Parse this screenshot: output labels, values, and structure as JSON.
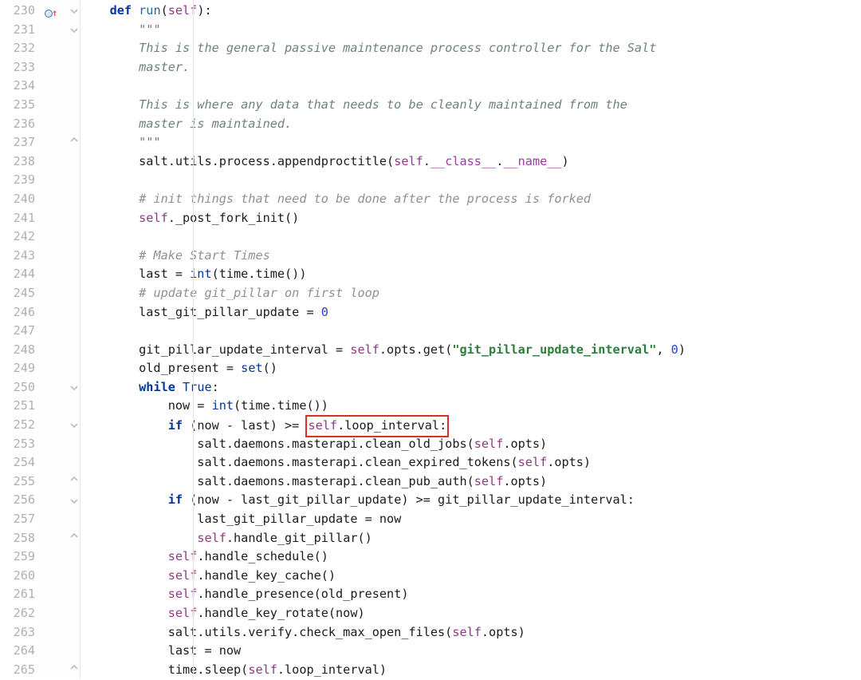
{
  "editor": {
    "first_line": 230,
    "last_line": 265,
    "highlight_text": "self.loop_interval:",
    "override_marker_line": 230
  },
  "fold_markers": [
    {
      "line": 230,
      "type": "open"
    },
    {
      "line": 231,
      "type": "open"
    },
    {
      "line": 237,
      "type": "close"
    },
    {
      "line": 250,
      "type": "open"
    },
    {
      "line": 252,
      "type": "open"
    },
    {
      "line": 255,
      "type": "close"
    },
    {
      "line": 256,
      "type": "open"
    },
    {
      "line": 258,
      "type": "close"
    },
    {
      "line": 265,
      "type": "close"
    }
  ],
  "code": [
    [
      [
        "pln",
        "    "
      ],
      [
        "kw",
        "def "
      ],
      [
        "fn",
        "run"
      ],
      [
        "pln",
        "("
      ],
      [
        "slf",
        "self"
      ],
      [
        "pln",
        "):"
      ]
    ],
    [
      [
        "pln",
        "        "
      ],
      [
        "ds",
        "\"\"\""
      ]
    ],
    [
      [
        "pln",
        "        "
      ],
      [
        "ds",
        "This is the general passive maintenance process controller for the Salt"
      ]
    ],
    [
      [
        "pln",
        "        "
      ],
      [
        "ds",
        "master."
      ]
    ],
    [
      [
        "pln",
        ""
      ]
    ],
    [
      [
        "pln",
        "        "
      ],
      [
        "ds",
        "This is where any data that needs to be cleanly maintained from the"
      ]
    ],
    [
      [
        "pln",
        "        "
      ],
      [
        "ds",
        "master is maintained."
      ]
    ],
    [
      [
        "pln",
        "        "
      ],
      [
        "ds",
        "\"\"\""
      ]
    ],
    [
      [
        "pln",
        "        salt.utils.process.appendproctitle("
      ],
      [
        "slf",
        "self"
      ],
      [
        "pln",
        "."
      ],
      [
        "dnd",
        "__class__"
      ],
      [
        "pln",
        "."
      ],
      [
        "dnd",
        "__name__"
      ],
      [
        "pln",
        ")"
      ]
    ],
    [
      [
        "pln",
        ""
      ]
    ],
    [
      [
        "pln",
        "        "
      ],
      [
        "cm",
        "# init things that need to be done after the process is forked"
      ]
    ],
    [
      [
        "pln",
        "        "
      ],
      [
        "slf",
        "self"
      ],
      [
        "pln",
        "._post_fork_init()"
      ]
    ],
    [
      [
        "pln",
        ""
      ]
    ],
    [
      [
        "pln",
        "        "
      ],
      [
        "cm",
        "# Make Start Times"
      ]
    ],
    [
      [
        "pln",
        "        last = "
      ],
      [
        "bi",
        "int"
      ],
      [
        "pln",
        "(time.time())"
      ]
    ],
    [
      [
        "pln",
        "        "
      ],
      [
        "cm",
        "# update git_pillar on first loop"
      ]
    ],
    [
      [
        "pln",
        "        last_git_pillar_update = "
      ],
      [
        "num",
        "0"
      ]
    ],
    [
      [
        "pln",
        ""
      ]
    ],
    [
      [
        "pln",
        "        git_pillar_update_interval = "
      ],
      [
        "slf",
        "self"
      ],
      [
        "pln",
        ".opts.get("
      ],
      [
        "str",
        "\"git_pillar_update_interval\""
      ],
      [
        "pln",
        ", "
      ],
      [
        "num",
        "0"
      ],
      [
        "pln",
        ")"
      ]
    ],
    [
      [
        "pln",
        "        old_present = "
      ],
      [
        "bi",
        "set"
      ],
      [
        "pln",
        "()"
      ]
    ],
    [
      [
        "pln",
        "        "
      ],
      [
        "kw",
        "while "
      ],
      [
        "bval",
        "True"
      ],
      [
        "pln",
        ":"
      ]
    ],
    [
      [
        "pln",
        "            now = "
      ],
      [
        "bi",
        "int"
      ],
      [
        "pln",
        "(time.time())"
      ]
    ],
    [
      [
        "pln",
        "            "
      ],
      [
        "kw",
        "if "
      ],
      [
        "pln",
        "(now - last) >= "
      ],
      [
        "hl",
        ""
      ],
      [
        "slf",
        "self"
      ],
      [
        "pln",
        ".loop_interval:"
      ],
      [
        "/hl",
        ""
      ]
    ],
    [
      [
        "pln",
        "                salt.daemons.masterapi.clean_old_jobs("
      ],
      [
        "slf",
        "self"
      ],
      [
        "pln",
        ".opts)"
      ]
    ],
    [
      [
        "pln",
        "                salt.daemons.masterapi.clean_expired_tokens("
      ],
      [
        "slf",
        "self"
      ],
      [
        "pln",
        ".opts)"
      ]
    ],
    [
      [
        "pln",
        "                salt.daemons.masterapi.clean_pub_auth("
      ],
      [
        "slf",
        "self"
      ],
      [
        "pln",
        ".opts)"
      ]
    ],
    [
      [
        "pln",
        "            "
      ],
      [
        "kw",
        "if "
      ],
      [
        "pln",
        "(now - last_git_pillar_update) >= git_pillar_update_interval:"
      ]
    ],
    [
      [
        "pln",
        "                last_git_pillar_update = now"
      ]
    ],
    [
      [
        "pln",
        "                "
      ],
      [
        "slf",
        "self"
      ],
      [
        "pln",
        ".handle_git_pillar()"
      ]
    ],
    [
      [
        "pln",
        "            "
      ],
      [
        "slf",
        "self"
      ],
      [
        "pln",
        ".handle_schedule()"
      ]
    ],
    [
      [
        "pln",
        "            "
      ],
      [
        "slf",
        "self"
      ],
      [
        "pln",
        ".handle_key_cache()"
      ]
    ],
    [
      [
        "pln",
        "            "
      ],
      [
        "slf",
        "self"
      ],
      [
        "pln",
        ".handle_presence(old_present)"
      ]
    ],
    [
      [
        "pln",
        "            "
      ],
      [
        "slf",
        "self"
      ],
      [
        "pln",
        ".handle_key_rotate(now)"
      ]
    ],
    [
      [
        "pln",
        "            salt.utils.verify.check_max_open_files("
      ],
      [
        "slf",
        "self"
      ],
      [
        "pln",
        ".opts)"
      ]
    ],
    [
      [
        "pln",
        "            last = now"
      ]
    ],
    [
      [
        "pln",
        "            time.sleep("
      ],
      [
        "slf",
        "self"
      ],
      [
        "pln",
        ".loop_interval)"
      ]
    ]
  ]
}
